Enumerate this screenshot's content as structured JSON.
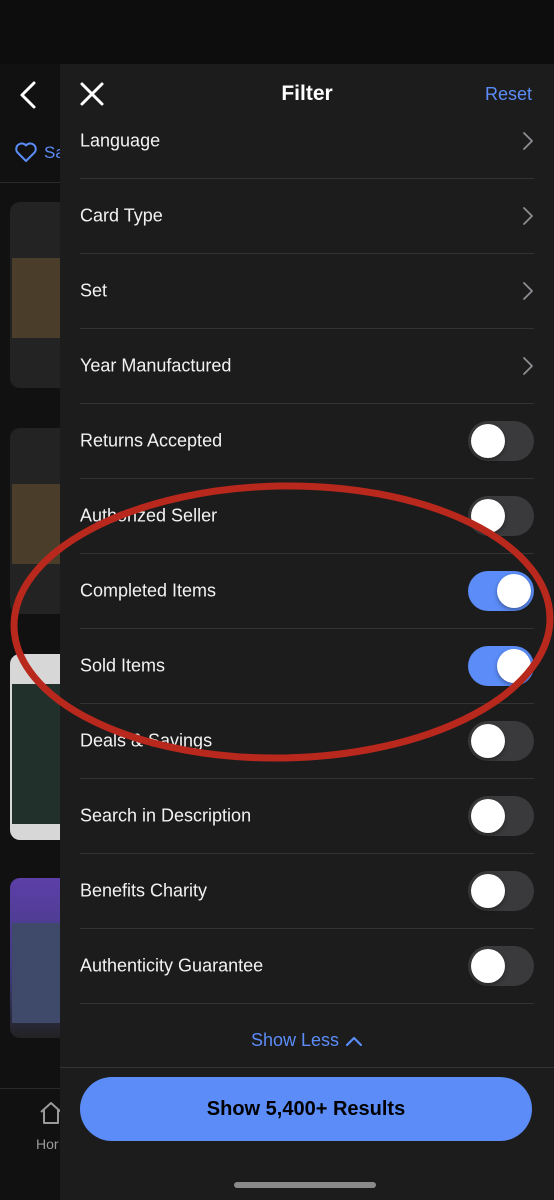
{
  "background_app": {
    "save_label": "Sa",
    "nav_home_label": "Hor"
  },
  "filter": {
    "title": "Filter",
    "reset_label": "Reset",
    "nav_rows": [
      {
        "label": "Language"
      },
      {
        "label": "Card Type"
      },
      {
        "label": "Set"
      },
      {
        "label": "Year Manufactured"
      }
    ],
    "toggle_rows": [
      {
        "label": "Returns Accepted",
        "on": false
      },
      {
        "label": "Authorized Seller",
        "on": false
      },
      {
        "label": "Completed Items",
        "on": true
      },
      {
        "label": "Sold Items",
        "on": true
      },
      {
        "label": "Deals & Savings",
        "on": false
      },
      {
        "label": "Search in Description",
        "on": false
      },
      {
        "label": "Benefits Charity",
        "on": false
      },
      {
        "label": "Authenticity Guarantee",
        "on": false
      }
    ],
    "show_less_label": "Show Less",
    "results_button_label": "Show 5,400+ Results"
  },
  "colors": {
    "accent": "#5b8cf7",
    "annotation": "#b8281c",
    "sheet_bg": "#1c1c1c"
  }
}
